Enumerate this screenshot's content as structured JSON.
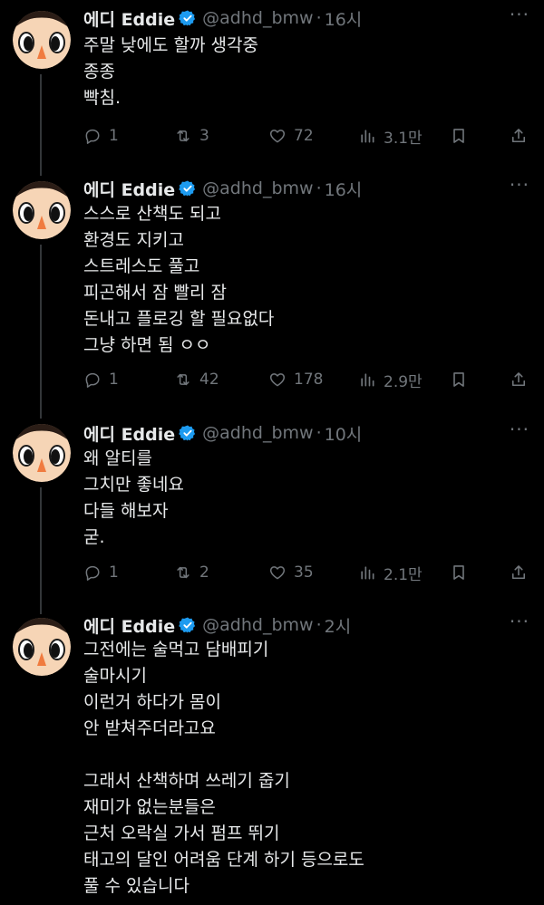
{
  "colors": {
    "background": "#000000",
    "text": "#e7e9ea",
    "muted": "#71767b",
    "verified": "#1d9bf0",
    "thread_line": "#333639"
  },
  "icons": {
    "reply": "reply-icon",
    "retweet": "retweet-icon",
    "like": "heart-icon",
    "views": "views-icon",
    "bookmark": "bookmark-icon",
    "share": "share-icon",
    "more": "more-icon",
    "verified": "verified-badge-icon"
  },
  "tweets": [
    {
      "name": "에디 Eddie",
      "handle": "@adhd_bmw",
      "sep": "·",
      "time": "16시",
      "more": "···",
      "lines": [
        "주말 낮에도 할까 생각중",
        "종종",
        "빡침."
      ],
      "replies": "1",
      "retweets": "3",
      "likes": "72",
      "views": "3.1만"
    },
    {
      "name": "에디 Eddie",
      "handle": "@adhd_bmw",
      "sep": "·",
      "time": "16시",
      "more": "···",
      "lines": [
        "스스로 산책도 되고",
        "환경도 지키고",
        "스트레스도 풀고",
        "피곤해서 잠 빨리 잠",
        "돈내고 플로깅 할 필요없다",
        "그냥 하면 됨 ㅇㅇ"
      ],
      "replies": "1",
      "retweets": "42",
      "likes": "178",
      "views": "2.9만"
    },
    {
      "name": "에디 Eddie",
      "handle": "@adhd_bmw",
      "sep": "·",
      "time": "10시",
      "more": "···",
      "lines": [
        "왜 알티를",
        "그치만 좋네요",
        "다들 해보자",
        "굳."
      ],
      "replies": "1",
      "retweets": "2",
      "likes": "35",
      "views": "2.1만"
    },
    {
      "name": "에디 Eddie",
      "handle": "@adhd_bmw",
      "sep": "·",
      "time": "2시",
      "more": "···",
      "lines": [
        "그전에는 술먹고 담배피기",
        "술마시기",
        "이런거 하다가 몸이",
        "안 받쳐주더라고요",
        "",
        "그래서 산책하며 쓰레기 줍기",
        "재미가 없는분들은",
        "근처 오락실 가서 펌프 뛰기",
        "태고의 달인 어려움 단계 하기 등으로도",
        "풀 수 있습니다"
      ]
    }
  ]
}
